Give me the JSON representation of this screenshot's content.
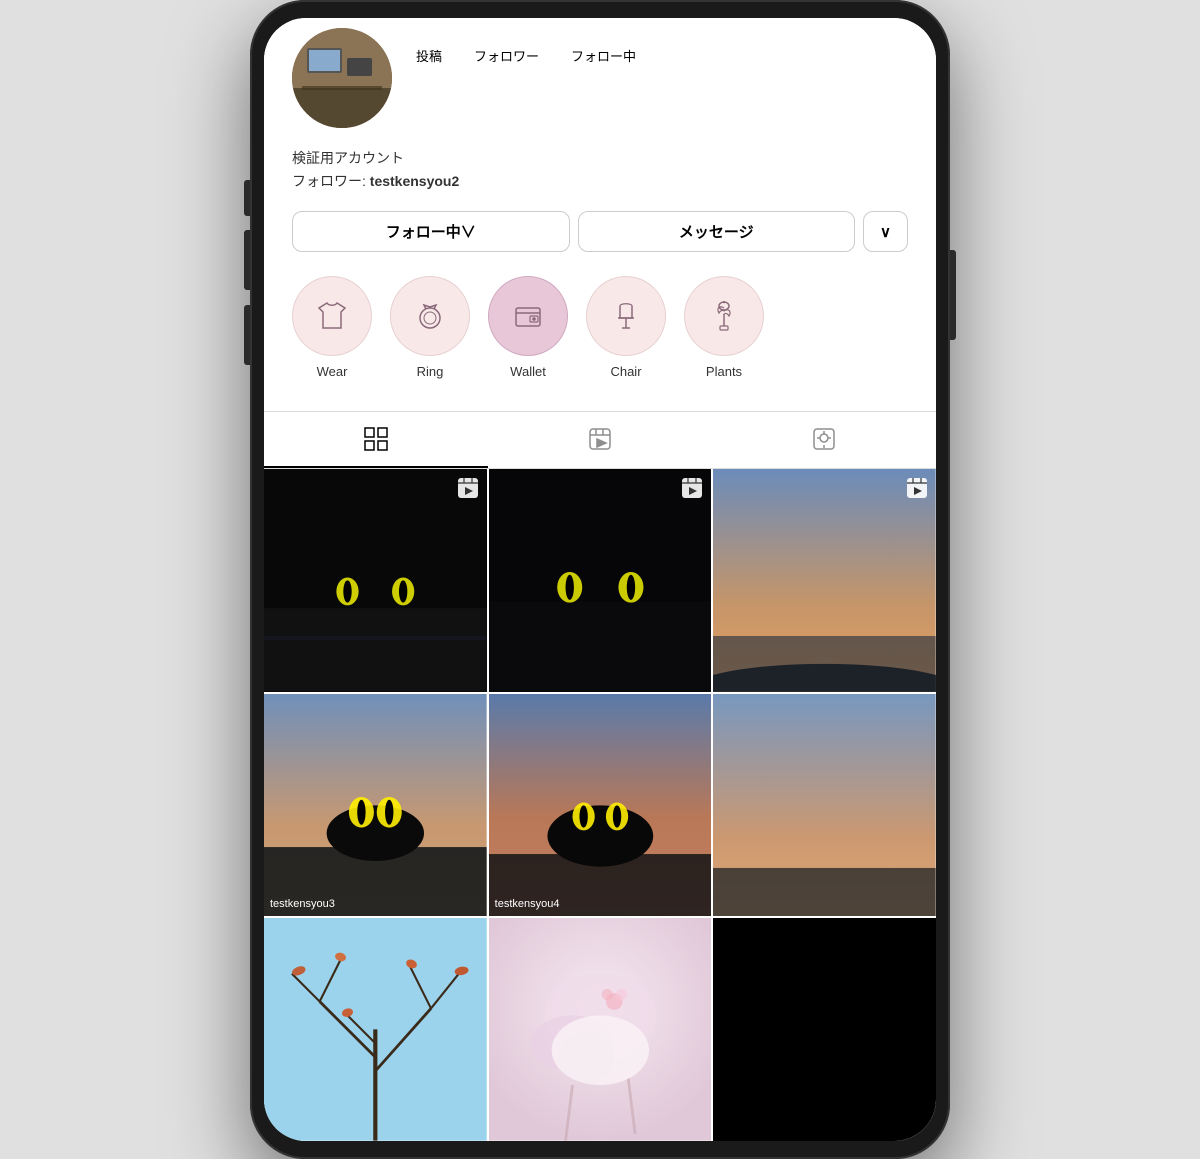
{
  "phone": {
    "profile": {
      "avatar_alt": "Profile avatar",
      "stats": [
        {
          "number": "",
          "label": "投稿"
        },
        {
          "number": "",
          "label": "フォロワー"
        },
        {
          "number": "",
          "label": "フォロー中"
        }
      ],
      "description": "検証用アカウント",
      "follower_text": "フォロワー: ",
      "follower_name": "testkensyou2",
      "buttons": {
        "follow": "フォロー中∨",
        "message": "メッセージ",
        "more": "∨"
      }
    },
    "highlights": [
      {
        "label": "Wear",
        "icon": "shirt"
      },
      {
        "label": "Ring",
        "icon": "ring"
      },
      {
        "label": "Wallet",
        "icon": "wallet"
      },
      {
        "label": "Chair",
        "icon": "chair"
      },
      {
        "label": "Plants",
        "icon": "plant"
      }
    ],
    "tabs": [
      {
        "icon": "grid",
        "active": true
      },
      {
        "icon": "reels",
        "active": false
      },
      {
        "icon": "tagged",
        "active": false
      }
    ],
    "grid": [
      {
        "type": "reel",
        "label": "",
        "style": "cat1"
      },
      {
        "type": "reel",
        "label": "",
        "style": "cat2"
      },
      {
        "type": "reel",
        "label": "",
        "style": "sunset"
      },
      {
        "type": "photo",
        "label": "testkensyou3",
        "style": "cat-black"
      },
      {
        "type": "photo",
        "label": "testkensyou4",
        "style": "cat-black2"
      },
      {
        "type": "photo",
        "label": "",
        "style": "sunset2"
      },
      {
        "type": "photo",
        "label": "",
        "style": "branches"
      },
      {
        "type": "photo",
        "label": "",
        "style": "soft"
      },
      {
        "type": "empty",
        "label": "",
        "style": "black"
      }
    ]
  }
}
